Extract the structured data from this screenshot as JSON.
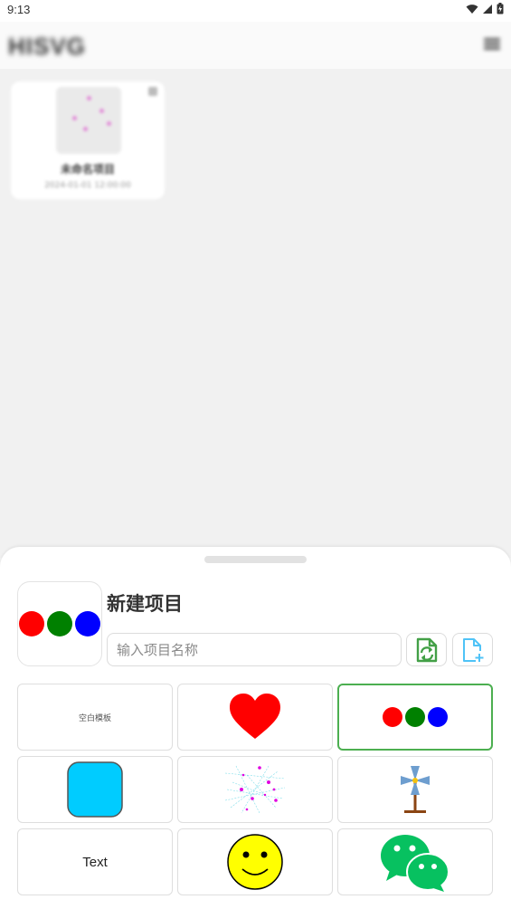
{
  "status_bar": {
    "time": "9:13",
    "icons": [
      "wifi-icon",
      "signal-icon",
      "battery-charging-icon"
    ]
  },
  "app_bar": {
    "title": "HISVG",
    "menu_icon": "menu-icon"
  },
  "projects": [
    {
      "name": "未命名项目",
      "date": "2024-01-01 12:00:00",
      "close_icon": "close-icon"
    }
  ],
  "sheet": {
    "title": "新建项目",
    "name_input": {
      "value": "",
      "placeholder": "输入项目名称"
    },
    "import_icon": "import-file-icon",
    "new_file_icon": "new-file-icon",
    "templates": [
      {
        "id": "blank",
        "label": "空白模板",
        "icon": "blank-template"
      },
      {
        "id": "heart",
        "label": "",
        "icon": "heart-icon"
      },
      {
        "id": "circles",
        "label": "",
        "icon": "three-circles-icon",
        "selected": true
      },
      {
        "id": "rounded-square",
        "label": "",
        "icon": "rounded-square-icon"
      },
      {
        "id": "network",
        "label": "",
        "icon": "network-graph-icon"
      },
      {
        "id": "windmill",
        "label": "",
        "icon": "windmill-icon"
      },
      {
        "id": "text",
        "label": "Text",
        "icon": "text-template"
      },
      {
        "id": "smiley",
        "label": "",
        "icon": "smiley-face-icon"
      },
      {
        "id": "wechat",
        "label": "",
        "icon": "wechat-icon"
      }
    ]
  },
  "colors": {
    "red": "#ff0000",
    "green": "#008000",
    "blue": "#0000ff",
    "heart": "#ff0000",
    "square": "#00ccff",
    "smiley": "#ffff00",
    "wechat": "#07c160",
    "accent": "#4caf50",
    "new_file": "#4fc3f7"
  }
}
